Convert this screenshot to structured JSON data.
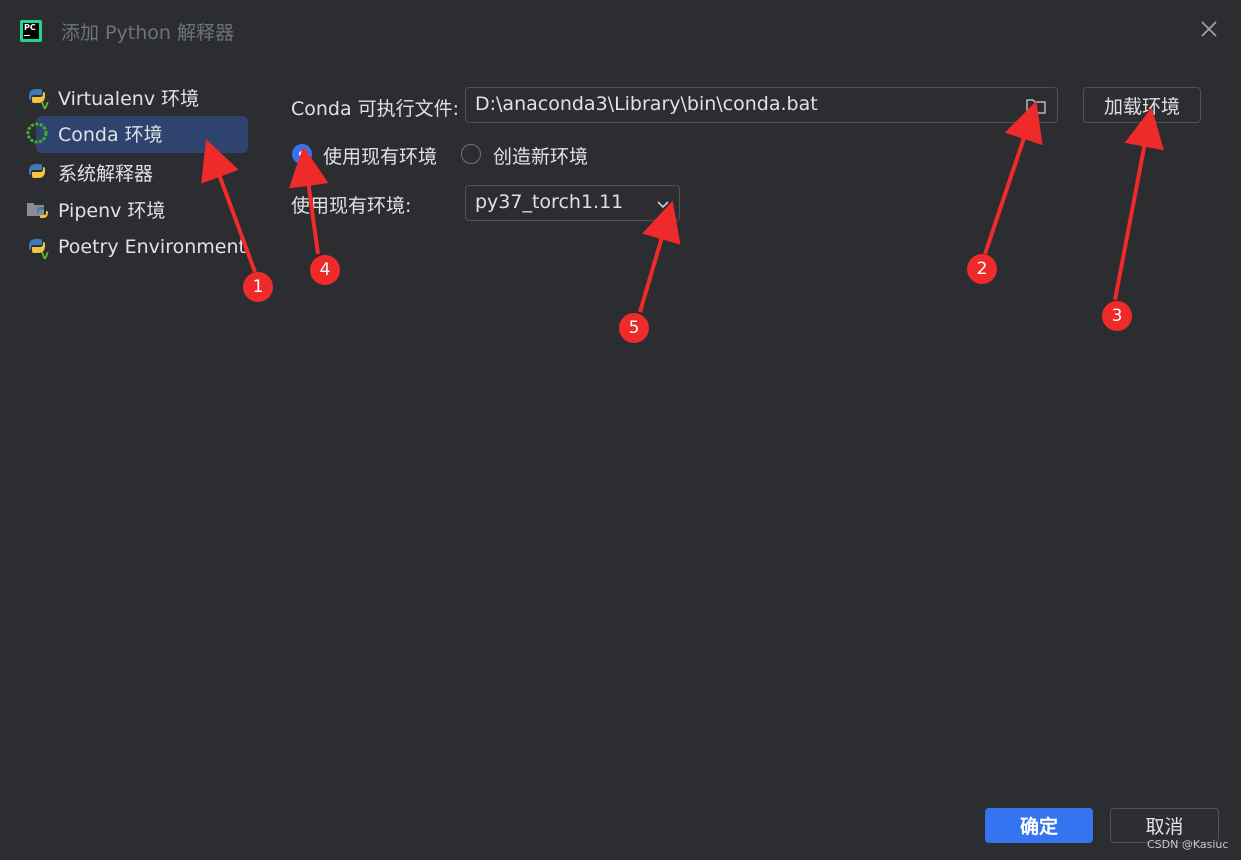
{
  "window": {
    "title": "添加 Python 解释器"
  },
  "sidebar": {
    "items": [
      {
        "label": "Virtualenv 环境",
        "icon": "python-virtualenv-icon"
      },
      {
        "label": "Conda 环境",
        "icon": "conda-icon",
        "selected": true
      },
      {
        "label": "系统解释器",
        "icon": "python-icon"
      },
      {
        "label": "Pipenv 环境",
        "icon": "pipenv-icon"
      },
      {
        "label": "Poetry Environment",
        "icon": "poetry-icon"
      }
    ]
  },
  "main": {
    "conda_exec_label": "Conda 可执行文件:",
    "conda_exec_value": "D:\\anaconda3\\Library\\bin\\conda.bat",
    "load_env_button": "加载环境",
    "radio_existing": "使用现有环境",
    "radio_new": "创造新环境",
    "existing_env_label": "使用现有环境:",
    "existing_env_value": "py37_torch1.11"
  },
  "footer": {
    "ok_button": "确定",
    "cancel_button": "取消"
  },
  "annotations": [
    "1",
    "2",
    "3",
    "4",
    "5"
  ],
  "watermark": "CSDN @Kasiuc",
  "colors": {
    "background": "#2b2d30",
    "accent": "#3574f0",
    "selection": "#2e436e",
    "annotation": "#ef2a2a"
  }
}
